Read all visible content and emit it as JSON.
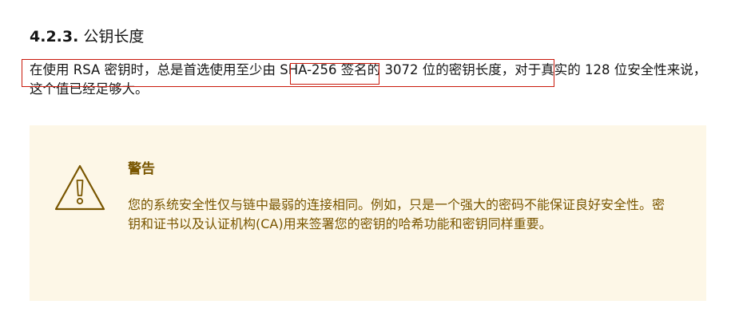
{
  "section": {
    "number": "4.2.3.",
    "title": "公钥长度"
  },
  "paragraph": {
    "text": "在使用 RSA 密钥时，总是首选使用至少由 SHA-256 签名的 3072 位的密钥长度，对于真实的 128 位安全性来说，这个值已经足够大。"
  },
  "warning": {
    "icon": "warning-triangle-icon",
    "title": "警告",
    "text": "您的系统安全性仅与链中最弱的连接相同。例如，只是一个强大的密码不能保证良好安全性。密钥和证书以及认证机构(CA)用来签署您的密钥的哈希功能和密钥同样重要。"
  },
  "colors": {
    "annotation": "#c9190b",
    "warning_background": "#fdf7e7",
    "warning_text": "#795600"
  }
}
